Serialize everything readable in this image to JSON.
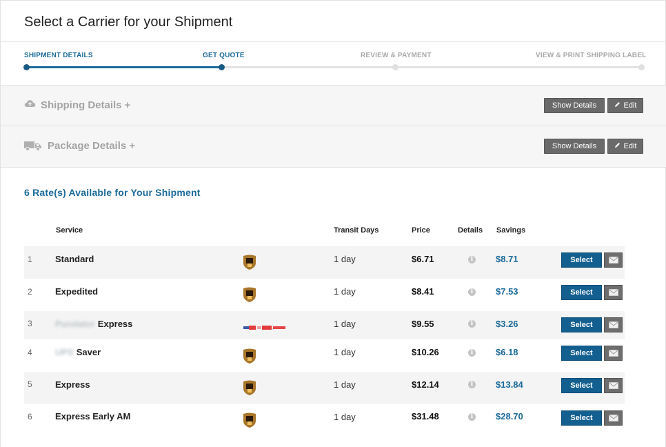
{
  "page": {
    "title": "Select a Carrier for your Shipment"
  },
  "progress": {
    "steps": [
      {
        "label": "SHIPMENT DETAILS",
        "state": "done"
      },
      {
        "label": "GET QUOTE",
        "state": "done"
      },
      {
        "label": "REVIEW & PAYMENT",
        "state": "todo"
      },
      {
        "label": "VIEW & PRINT SHIPPING LABEL",
        "state": "todo"
      }
    ]
  },
  "sections": {
    "shipping": {
      "title": "Shipping Details +",
      "icon": "cloud-upload-icon",
      "show_label": "Show Details",
      "edit_label": "Edit"
    },
    "package": {
      "title": "Package Details +",
      "icon": "truck-icon",
      "show_label": "Show Details",
      "edit_label": "Edit"
    }
  },
  "rates": {
    "heading": "6 Rate(s) Available for Your Shipment",
    "columns": {
      "service": "Service",
      "transit": "Transit Days",
      "price": "Price",
      "details": "Details",
      "savings": "Savings"
    },
    "select_label": "Select",
    "rows": [
      {
        "index": "1",
        "prefix": "",
        "service": "Standard",
        "transit": "1 day",
        "price": "$6.71",
        "savings": "$8.71",
        "logo": "ups-logo"
      },
      {
        "index": "2",
        "prefix": "",
        "service": "Expedited",
        "transit": "1 day",
        "price": "$8.41",
        "savings": "$7.53",
        "logo": "ups-logo"
      },
      {
        "index": "3",
        "prefix": "Purolator",
        "service": "Express",
        "transit": "1 day",
        "price": "$9.55",
        "savings": "$3.26",
        "logo": "purolator-logo"
      },
      {
        "index": "4",
        "prefix": "UPS",
        "service": "Saver",
        "transit": "1 day",
        "price": "$10.26",
        "savings": "$6.18",
        "logo": "ups-logo"
      },
      {
        "index": "5",
        "prefix": "",
        "service": "Express",
        "transit": "1 day",
        "price": "$12.14",
        "savings": "$13.84",
        "logo": "ups-logo"
      },
      {
        "index": "6",
        "prefix": "",
        "service": "Express Early AM",
        "transit": "1 day",
        "price": "$31.48",
        "savings": "$28.70",
        "logo": "ups-logo"
      }
    ]
  },
  "colors": {
    "accent": "#1a6a9a",
    "select_button": "#135f8f",
    "gray_button": "#6a6a6a"
  }
}
